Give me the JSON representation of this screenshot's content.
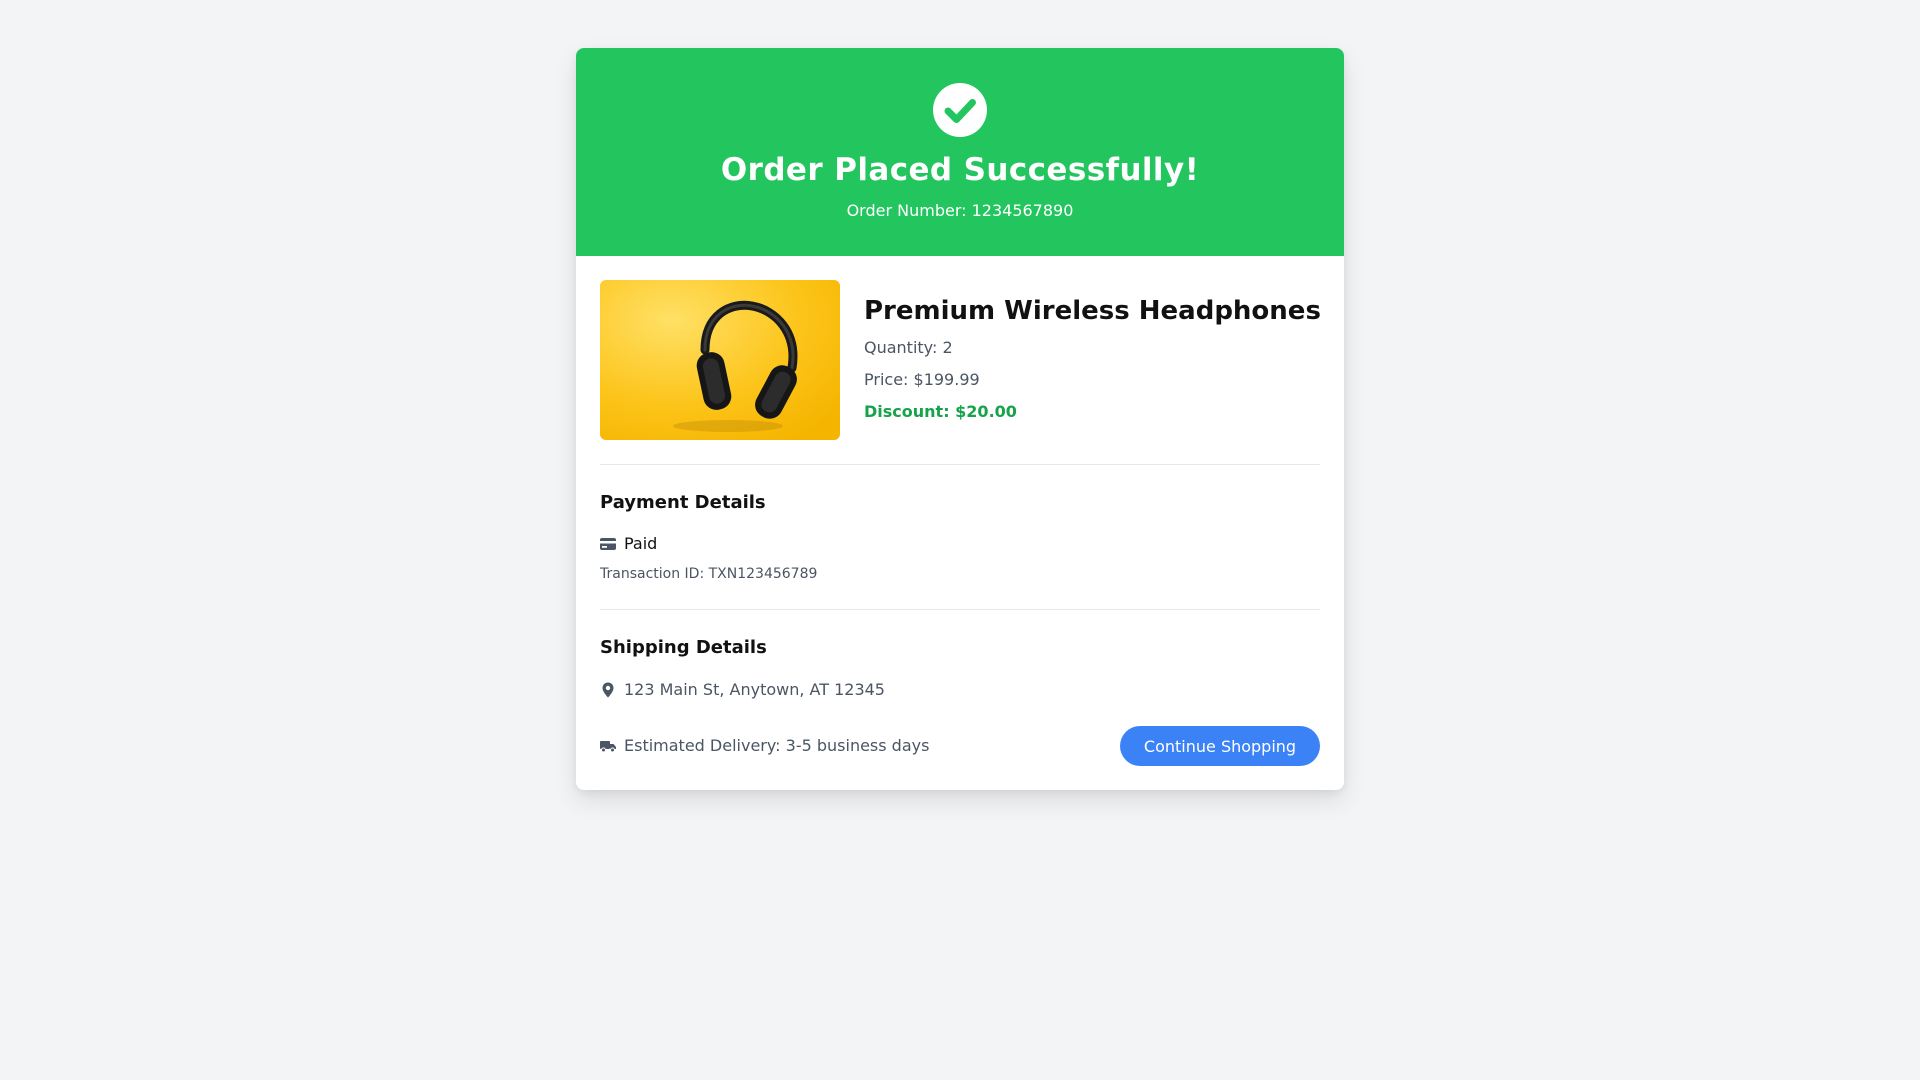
{
  "banner": {
    "title": "Order Placed Successfully!",
    "order_number": "Order Number: 1234567890",
    "background": "#22c55e",
    "icon": "check-circle-icon"
  },
  "product": {
    "name": "Premium Wireless Headphones",
    "quantity": "Quantity: 2",
    "price": "Price: $199.99",
    "discount": "Discount: $20.00",
    "image": "headphones on yellow background"
  },
  "payment": {
    "heading": "Payment Details",
    "status": "Paid",
    "status_icon": "credit-card-icon",
    "transaction": "Transaction ID: TXN123456789"
  },
  "shipping": {
    "heading": "Shipping Details",
    "address": "123 Main St, Anytown, AT 12345",
    "address_icon": "map-pin-icon",
    "delivery": "Estimated Delivery: 3-5 business days",
    "delivery_icon": "truck-icon"
  },
  "actions": {
    "continue_label": "Continue Shopping",
    "accent": "#3b82f6"
  }
}
